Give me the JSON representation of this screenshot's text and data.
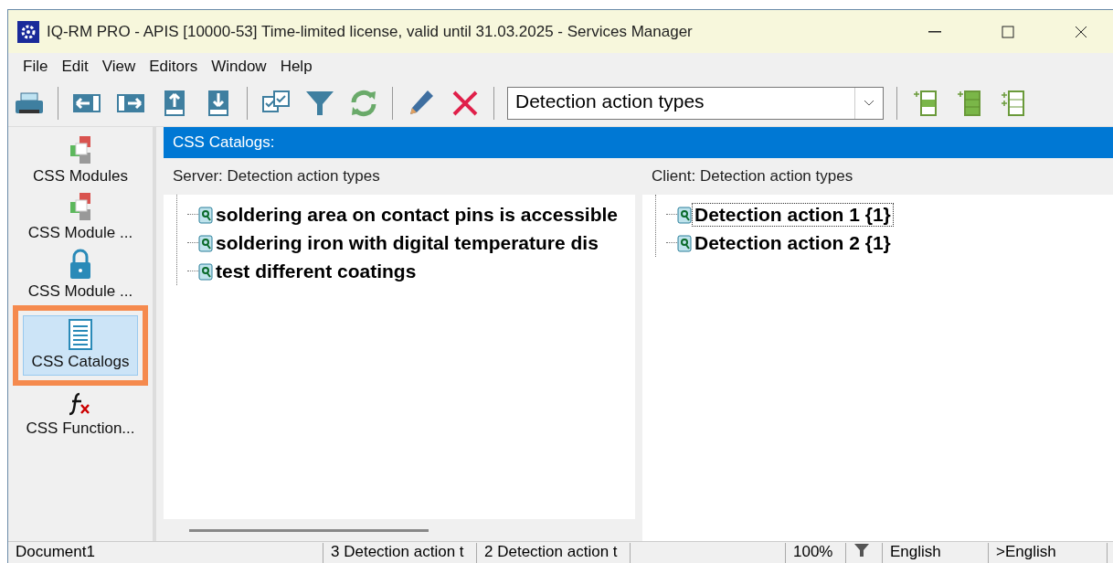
{
  "window": {
    "title": "IQ-RM PRO - APIS [10000-53] Time-limited license, valid until 31.03.2025 - Services Manager"
  },
  "menu": [
    {
      "label": "File"
    },
    {
      "label": "Edit"
    },
    {
      "label": "View"
    },
    {
      "label": "Editors"
    },
    {
      "label": "Window"
    },
    {
      "label": "Help"
    }
  ],
  "toolbar": {
    "combo": {
      "value": "Detection action types"
    }
  },
  "sidebar": {
    "items": [
      {
        "label": "CSS Modules",
        "kind": "modules",
        "selected": false
      },
      {
        "label": "CSS Module ...",
        "kind": "modules",
        "selected": false
      },
      {
        "label": "CSS Module ...",
        "kind": "lock",
        "selected": false
      },
      {
        "label": "CSS Catalogs",
        "kind": "catalog",
        "selected": true
      },
      {
        "label": "CSS Function...",
        "kind": "function",
        "selected": false
      }
    ]
  },
  "panel": {
    "title": "CSS Catalogs:",
    "server": {
      "header": "Server: Detection action types",
      "items": [
        {
          "label": "soldering area on contact pins is accessible",
          "focused": false
        },
        {
          "label": "soldering iron with digital temperature dis",
          "focused": false
        },
        {
          "label": "test different coatings",
          "focused": false
        }
      ]
    },
    "client": {
      "header": "Client: Detection action types",
      "items": [
        {
          "label": "Detection action 1 {1}",
          "focused": true
        },
        {
          "label": "Detection action 2 {1}",
          "focused": false
        }
      ]
    }
  },
  "status_bar": [
    {
      "kind": "text",
      "text": "Document1"
    },
    {
      "kind": "text",
      "text": "3 Detection action t"
    },
    {
      "kind": "text",
      "text": "2 Detection action t"
    },
    {
      "kind": "blank"
    },
    {
      "kind": "text",
      "text": "100%"
    },
    {
      "kind": "filter"
    },
    {
      "kind": "text",
      "text": "English"
    },
    {
      "kind": "text",
      "text": ">English"
    }
  ]
}
